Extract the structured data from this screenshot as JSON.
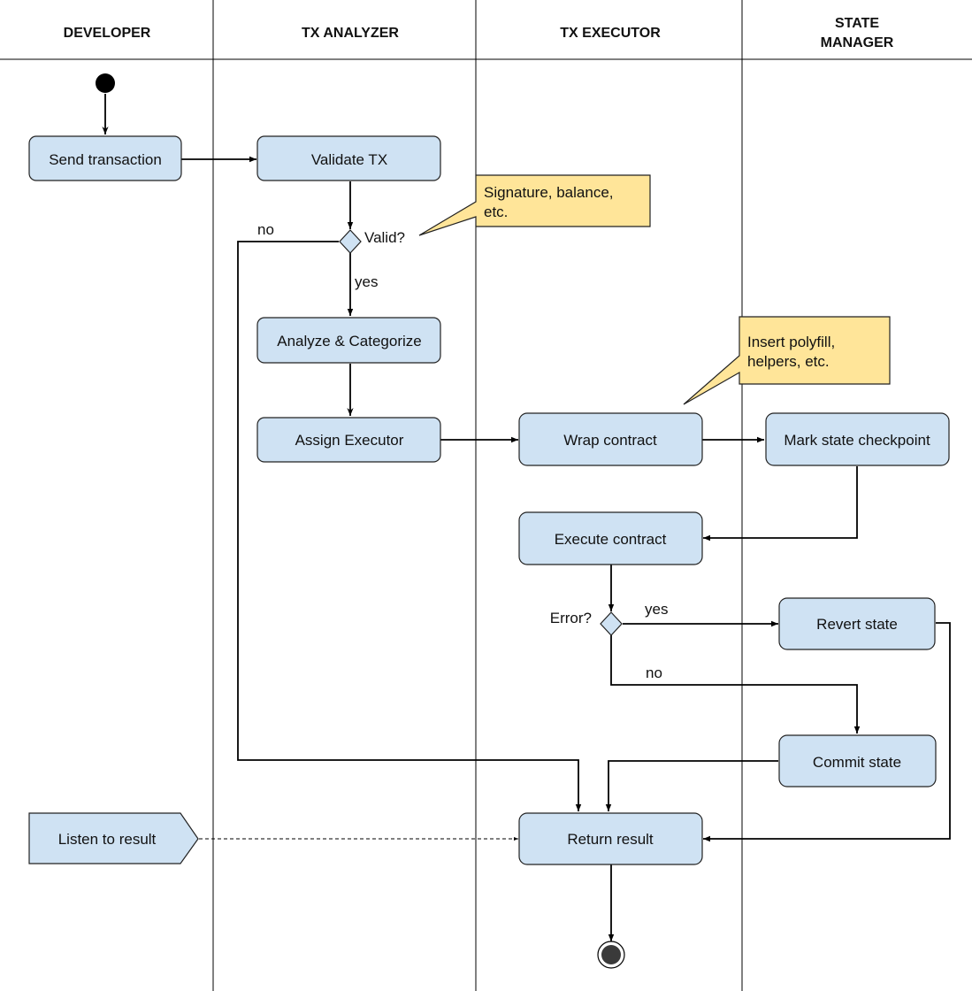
{
  "diagram": {
    "type": "uml-activity-swimlane",
    "lanes": [
      {
        "id": "developer",
        "title": "DEVELOPER"
      },
      {
        "id": "analyzer",
        "title": "TX ANALYZER"
      },
      {
        "id": "executor",
        "title": "TX EXECUTOR"
      },
      {
        "id": "state",
        "title_line1": "STATE",
        "title_line2": "MANAGER"
      }
    ],
    "nodes": {
      "send": "Send transaction",
      "validate": "Validate TX",
      "valid_decision": "Valid?",
      "analyze": "Analyze & Categorize",
      "assign": "Assign Executor",
      "wrap": "Wrap contract",
      "mark": "Mark state checkpoint",
      "execute": "Execute contract",
      "error_decision": "Error?",
      "revert": "Revert state",
      "commit": "Commit state",
      "listen": "Listen to result",
      "return": "Return result"
    },
    "edge_labels": {
      "valid_no": "no",
      "valid_yes": "yes",
      "error_yes": "yes",
      "error_no": "no"
    },
    "notes": {
      "validate_note_line1": "Signature, balance,",
      "validate_note_line2": "etc.",
      "wrap_note_line1": "Insert polyfill,",
      "wrap_note_line2": "helpers, etc."
    },
    "colors": {
      "activity_fill": "#cfe2f3",
      "note_fill": "#ffe599",
      "stroke": "#000000"
    }
  }
}
